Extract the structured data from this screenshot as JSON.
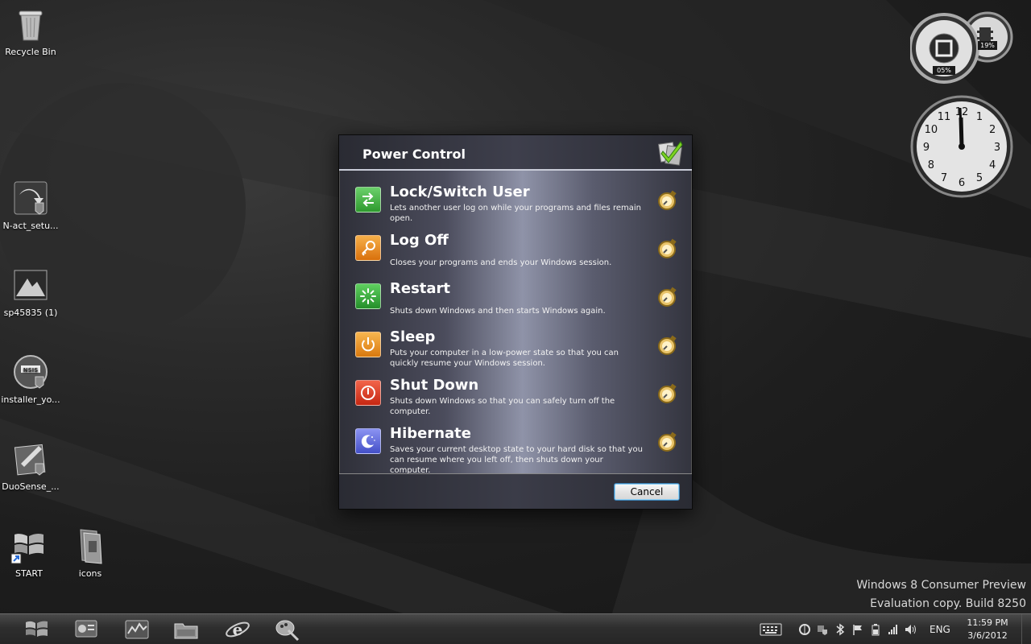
{
  "desktop": {
    "icons": [
      {
        "label": "Recycle Bin",
        "icon": "recycle-bin-icon"
      },
      {
        "label": "N-act_setu...",
        "icon": "installer-icon"
      },
      {
        "label": "sp45835 (1)",
        "icon": "installer-icon"
      },
      {
        "label": "installer_yo...",
        "icon": "installer-icon"
      },
      {
        "label": "DuoSense_...",
        "icon": "installer-icon"
      },
      {
        "label": "START",
        "icon": "windows-logo-icon"
      },
      {
        "label": "icons",
        "icon": "folder-icon"
      }
    ],
    "watermark": {
      "line1": "Windows 8 Consumer Preview",
      "line2": "Evaluation copy. Build 8250"
    }
  },
  "gadgets": {
    "meter": {
      "cpu": "05%",
      "memory": "19%"
    },
    "clock": {
      "numerals": [
        "12",
        "1",
        "2",
        "3",
        "4",
        "5",
        "6",
        "7",
        "8",
        "9",
        "10",
        "11"
      ]
    }
  },
  "dialog": {
    "title": "Power Control",
    "options": [
      {
        "title": "Lock/Switch User",
        "desc": "Lets another user log on while your programs and files remain open.",
        "icon": "switch-user-icon",
        "color": "#3aa53a"
      },
      {
        "title": "Log Off",
        "desc": "Closes your programs and ends your Windows session.",
        "icon": "key-icon",
        "color": "#e07c12"
      },
      {
        "title": "Restart",
        "desc": "Shuts down Windows and then starts Windows again.",
        "icon": "restart-icon",
        "color": "#2f9d3a"
      },
      {
        "title": "Sleep",
        "desc": "Puts your computer in a low-power state so that you can quickly resume your Windows session.",
        "icon": "power-icon",
        "color": "#e08a18"
      },
      {
        "title": "Shut Down",
        "desc": "Shuts down Windows so that you can safely turn off the computer.",
        "icon": "power-icon",
        "color": "#d63a20"
      },
      {
        "title": "Hibernate",
        "desc": "Saves your current desktop state to your hard disk so that you can resume where you left off, then shuts down your computer.",
        "icon": "moon-icon",
        "color": "#5a63d8"
      }
    ],
    "cancel_label": "Cancel"
  },
  "taskbar": {
    "pinned": [
      "start-icon",
      "control-panel-icon",
      "task-manager-icon",
      "file-explorer-icon",
      "internet-explorer-icon",
      "paint-icon"
    ],
    "tray_lang": "ENG",
    "time": "11:59 PM",
    "date": "3/6/2012"
  }
}
